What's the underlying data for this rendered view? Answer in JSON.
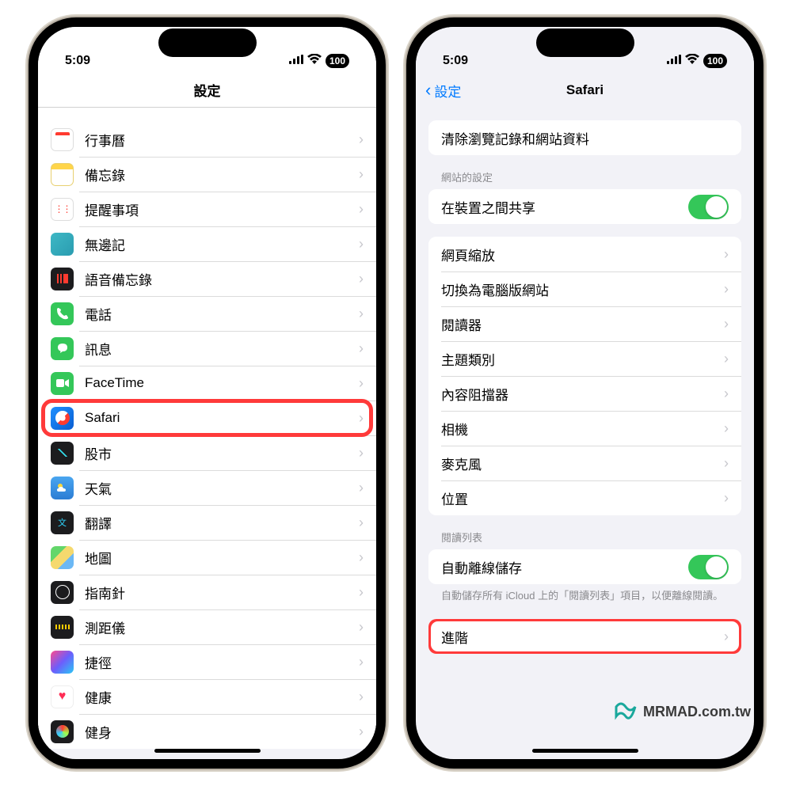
{
  "status": {
    "time": "5:09",
    "battery": "100"
  },
  "left": {
    "nav_title": "設定",
    "rows": [
      {
        "label": "行事曆"
      },
      {
        "label": "備忘錄"
      },
      {
        "label": "提醒事項"
      },
      {
        "label": "無邊記"
      },
      {
        "label": "語音備忘錄"
      },
      {
        "label": "電話"
      },
      {
        "label": "訊息"
      },
      {
        "label": "FaceTime"
      },
      {
        "label": "Safari"
      },
      {
        "label": "股市"
      },
      {
        "label": "天氣"
      },
      {
        "label": "翻譯"
      },
      {
        "label": "地圖"
      },
      {
        "label": "指南針"
      },
      {
        "label": "測距儀"
      },
      {
        "label": "捷徑"
      },
      {
        "label": "健康"
      },
      {
        "label": "健身"
      }
    ]
  },
  "right": {
    "nav_back": "設定",
    "nav_title": "Safari",
    "clear_row": "清除瀏覽記錄和網站資料",
    "section_website": "網站的設定",
    "share_row": "在裝置之間共享",
    "website_rows": [
      {
        "label": "網頁縮放"
      },
      {
        "label": "切換為電腦版網站"
      },
      {
        "label": "閱讀器"
      },
      {
        "label": "主題類別"
      },
      {
        "label": "內容阻擋器"
      },
      {
        "label": "相機"
      },
      {
        "label": "麥克風"
      },
      {
        "label": "位置"
      }
    ],
    "section_reading": "閱讀列表",
    "auto_save_row": "自動離線儲存",
    "reading_footer": "自動儲存所有 iCloud 上的「閱讀列表」項目，以便離線閱讀。",
    "advanced_row": "進階"
  },
  "watermark": "MRMAD.com.tw"
}
